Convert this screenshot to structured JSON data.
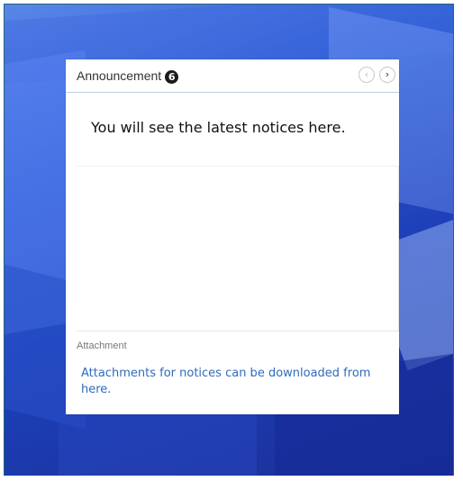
{
  "announcement": {
    "title": "Announcement",
    "count": "6",
    "prev_icon": "chevron-left-icon",
    "next_icon": "chevron-right-icon",
    "prev_glyph": "‹",
    "next_glyph": "›",
    "notice_text": "You will see the latest notices here."
  },
  "attachment": {
    "label": "Attachment",
    "link_text": "Attachments for notices can be downloaded from here."
  },
  "colors": {
    "accent": "#2f6bbd",
    "header_border": "#b9cde8",
    "background_blue": "#2f5fd6"
  }
}
